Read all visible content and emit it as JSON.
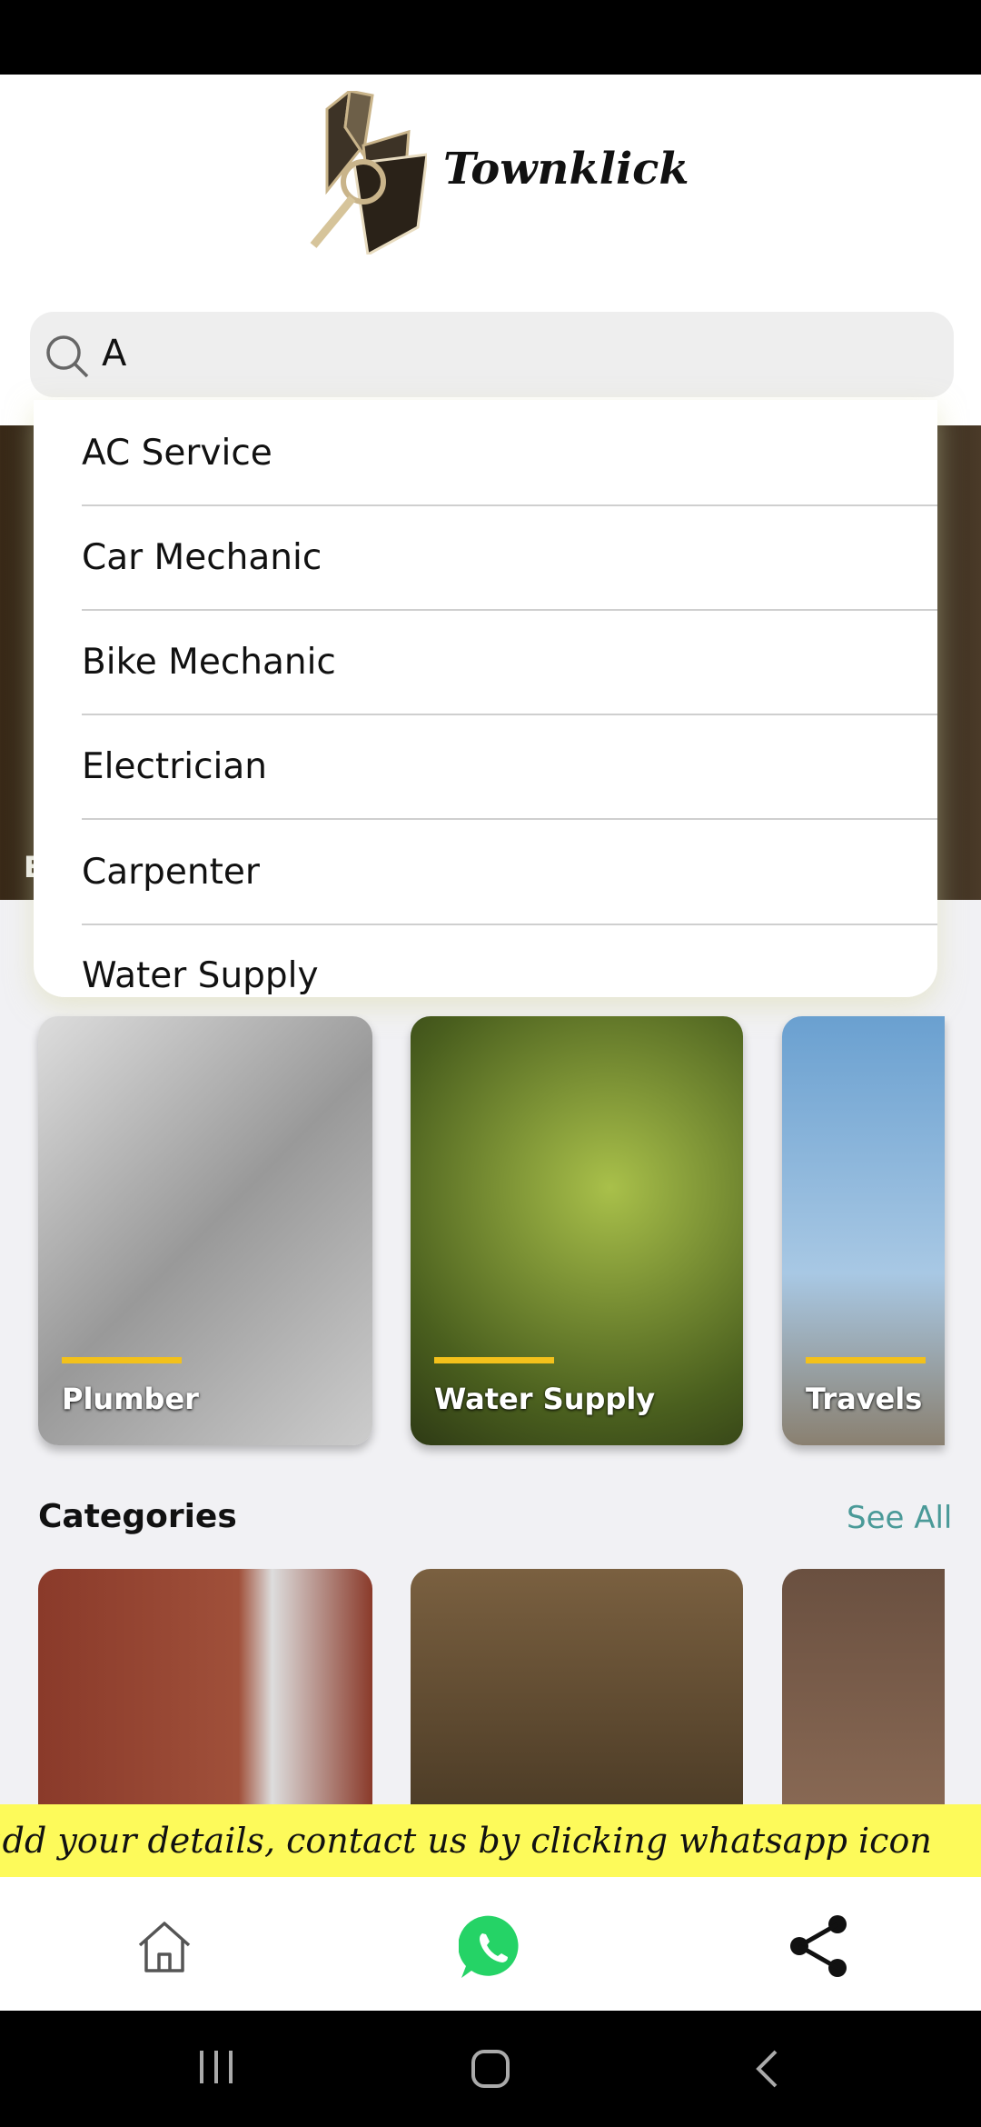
{
  "app": {
    "brand": "Townklick"
  },
  "search": {
    "value": "A"
  },
  "suggestions": [
    "AC Service",
    "Car Mechanic",
    "Bike Mechanic",
    "Electrician",
    "Carpenter",
    "Water Supply"
  ],
  "banner": {
    "partial_label": "E"
  },
  "featured": [
    {
      "label": "Plumber"
    },
    {
      "label": "Water Supply"
    },
    {
      "label": "Travels"
    }
  ],
  "categories": {
    "title": "Categories",
    "see_all": "See All"
  },
  "marquee": {
    "text": "add your details, contact us by clicking whatsapp icon"
  },
  "bottom_nav": {
    "icons": [
      "home-icon",
      "whatsapp-icon",
      "share-icon"
    ]
  },
  "colors": {
    "accent": "#4a9a98",
    "marquee_bg": "#fdfa5a",
    "card_bar": "#f3c11b",
    "whatsapp": "#25d366"
  }
}
